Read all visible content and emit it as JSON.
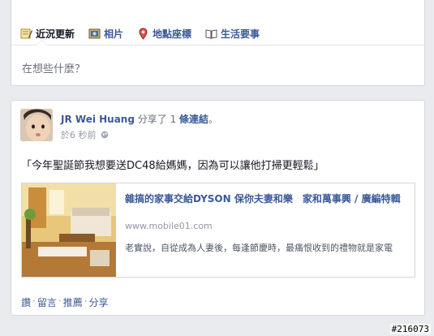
{
  "composer": {
    "tabs": [
      {
        "label": "近況更新",
        "icon": "status-icon"
      },
      {
        "label": "相片",
        "icon": "photo-icon"
      },
      {
        "label": "地點座標",
        "icon": "location-pin-icon"
      },
      {
        "label": "生活要事",
        "icon": "book-icon"
      }
    ],
    "placeholder": "在想些什麼？"
  },
  "post": {
    "author": "JR Wei Huang",
    "action_text": " 分享了 1 ",
    "link_word": "條連結",
    "action_end": "。",
    "time_prefix": "於 ",
    "time": "6 秒前",
    "privacy_icon": "globe-icon",
    "text": "「今年聖誕節我想要送DC48給媽媽，因為可以讓他打掃更輕鬆」",
    "link": {
      "title": "雜搞的家事交給DYSON 保你夫妻和樂　家和萬事興 / 廣編特輯",
      "domain": "www.mobile01.com",
      "description": "老實說，自從成為人妻後，每逢節慶時，最痛恨收到的禮物就是家電"
    },
    "actions": {
      "like": "讚",
      "comment": "留言",
      "recommend": "推薦",
      "share": "分享",
      "separator": "·"
    }
  },
  "watermark": "#216073",
  "colors": {
    "link_blue": "#3b5998",
    "background": "#e9ebee"
  }
}
